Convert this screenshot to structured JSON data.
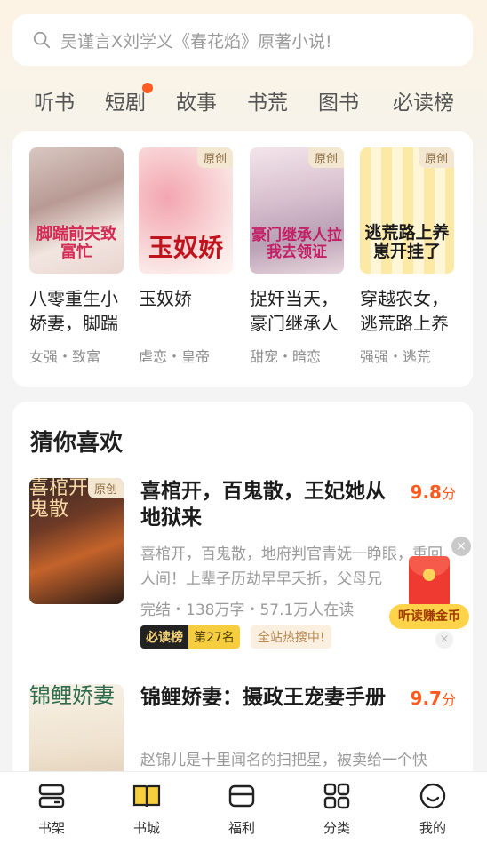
{
  "search": {
    "placeholder": "吴谨言X刘学义《春花焰》原著小说!"
  },
  "tabs": [
    {
      "label": "听书"
    },
    {
      "label": "短剧",
      "dot": true
    },
    {
      "label": "故事"
    },
    {
      "label": "书荒"
    },
    {
      "label": "图书"
    },
    {
      "label": "必读榜"
    }
  ],
  "featured": [
    {
      "title": "八零重生小娇妻，脚踹",
      "tags": "女强・致富",
      "badge": "",
      "cover_text": "脚踹前夫致富忙"
    },
    {
      "title": "玉奴娇",
      "tags": "虐恋・皇帝",
      "badge": "原创",
      "cover_text": "玉奴娇"
    },
    {
      "title": "捉奸当天，豪门继承人",
      "tags": "甜宠・暗恋",
      "badge": "原创",
      "cover_text": "豪门继承人拉我去领证"
    },
    {
      "title": "穿越农女，逃荒路上养",
      "tags": "强强・逃荒",
      "badge": "原创",
      "cover_text": "逃荒路上养崽开挂了"
    }
  ],
  "recommend": {
    "section_title": "猜你喜欢",
    "items": [
      {
        "title": "喜棺开，百鬼散，王妃她从地狱来",
        "score": "9.8",
        "score_unit": "分",
        "badge": "原创",
        "cover_text": "喜棺开百鬼散",
        "desc": "喜棺开，百鬼散，地府判官青妩一睁眼，重回人间！上辈子历劫早早夭折，父母兄",
        "meta": "完结・138万字・57.1万人在读",
        "rank_label": "必读榜",
        "rank_pos": "第27名",
        "hot": "全站热搜中!"
      },
      {
        "title": "锦鲤娇妻：摄政王宠妻手册",
        "score": "9.7",
        "score_unit": "分",
        "badge": "",
        "cover_text": "锦鲤娇妻",
        "desc": "赵锦儿是十里闻名的扫把星，被卖给一个快",
        "meta": "",
        "rank_label": "",
        "rank_pos": "",
        "hot": ""
      }
    ]
  },
  "float_widget": {
    "label": "听读赚金币",
    "close": "×"
  },
  "bottom_nav": [
    {
      "label": "书架"
    },
    {
      "label": "书城"
    },
    {
      "label": "福利"
    },
    {
      "label": "分类"
    },
    {
      "label": "我的"
    }
  ],
  "colors": {
    "accent": "#ff5a1f",
    "active_tab_icon": "#f6cd3e"
  }
}
